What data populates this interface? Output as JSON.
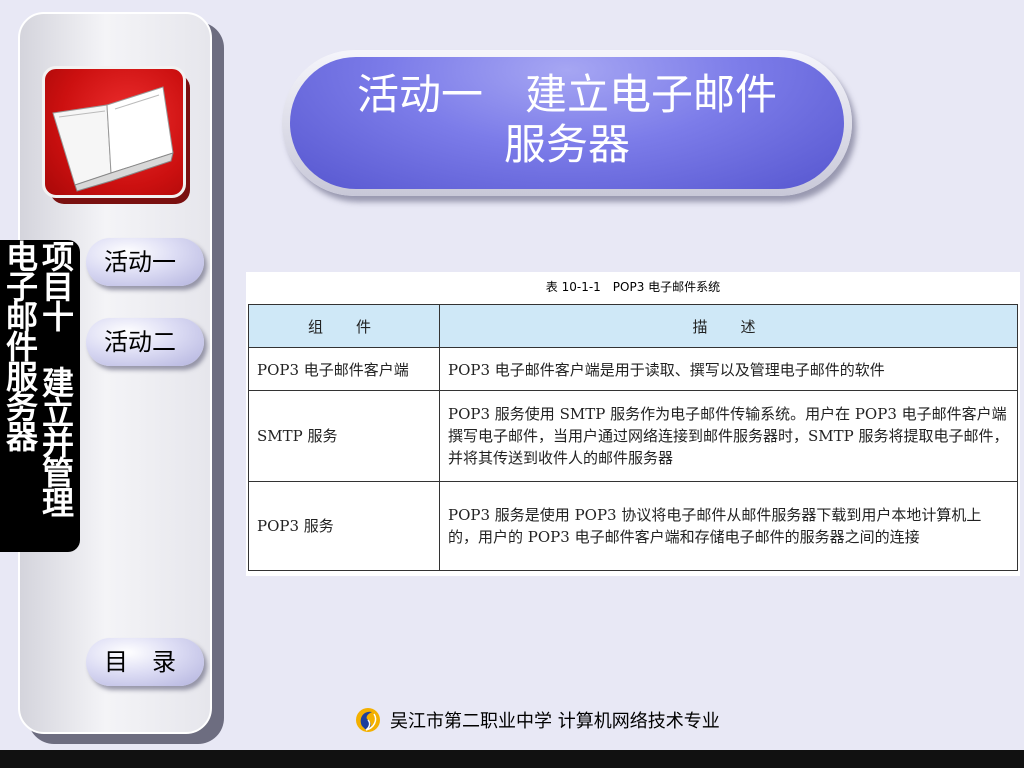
{
  "sidebar": {
    "nav": [
      {
        "label": "活动一"
      },
      {
        "label": "活动二"
      }
    ],
    "toc_label": "目　录",
    "project_title": {
      "col1": "项目十 建立并管理",
      "col2": "电子邮件服务器"
    }
  },
  "title": {
    "line1": "活动一　建立电子邮件",
    "line2": "服务器"
  },
  "table": {
    "caption": "表 10-1-1　POP3 电子邮件系统",
    "headers": [
      "组　件",
      "描　述"
    ],
    "rows": [
      {
        "component": "POP3 电子邮件客户端",
        "description": "POP3 电子邮件客户端是用于读取、撰写以及管理电子邮件的软件"
      },
      {
        "component": "SMTP 服务",
        "description": "POP3 服务使用 SMTP 服务作为电子邮件传输系统。用户在 POP3 电子邮件客户端撰写电子邮件，当用户通过网络连接到邮件服务器时，SMTP 服务将提取电子邮件，并将其传送到收件人的邮件服务器"
      },
      {
        "component": "POP3 服务",
        "description": "POP3 服务是使用 POP3 协议将电子邮件从邮件服务器下载到用户本地计算机上的，用户的 POP3 电子邮件客户端和存储电子邮件的服务器之间的连接"
      }
    ]
  },
  "footer": {
    "text": "吴江市第二职业中学 计算机网络技术专业",
    "logo_icon": "school-logo-icon"
  },
  "colors": {
    "banner": "#7c7ce9",
    "table_header": "#cfe8f7",
    "book_tile": "#cc1010",
    "background": "#e8e8f5"
  }
}
